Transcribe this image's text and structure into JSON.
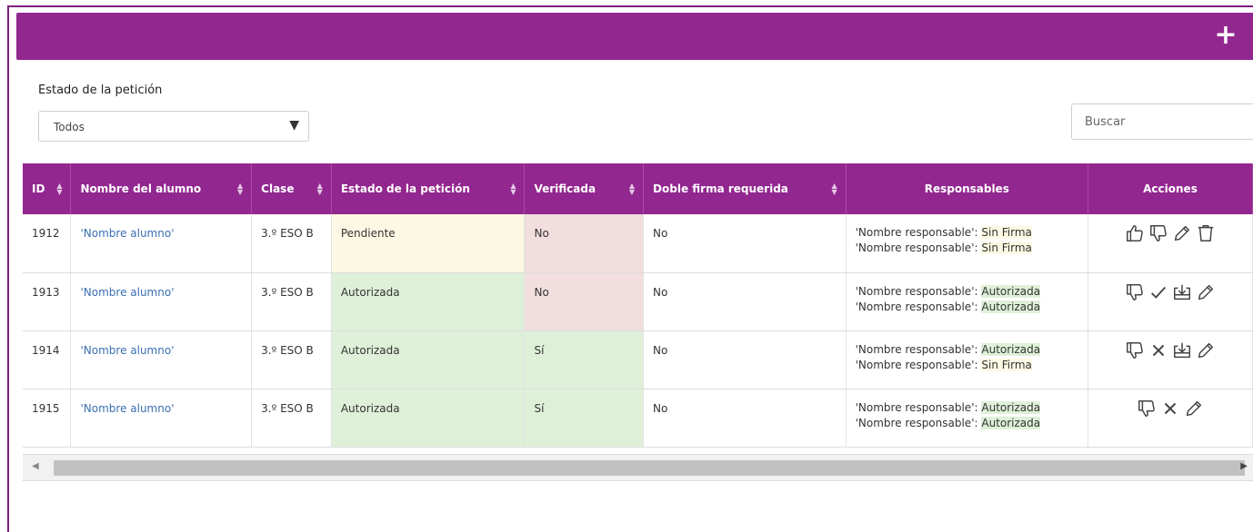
{
  "toolbar": {
    "add_label": "+"
  },
  "filter": {
    "label": "Estado de la petición",
    "selected": "Todos"
  },
  "search": {
    "placeholder": "Buscar"
  },
  "table": {
    "headers": [
      "ID",
      "Nombre del alumno",
      "Clase",
      "Estado de la petición",
      "Verificada",
      "Doble firma requerida",
      "Responsables",
      "Acciones"
    ],
    "rows": [
      {
        "id": "1912",
        "alumno": "'Nombre alumno'",
        "clase": "3.º ESO B",
        "estado": "Pendiente",
        "verificada": "No",
        "doble": "No",
        "responsables": [
          {
            "name": "'Nombre responsable':",
            "status": "Sin Firma"
          },
          {
            "name": "'Nombre responsable':",
            "status": "Sin Firma"
          }
        ],
        "actions": [
          "thumbs-up-icon",
          "thumbs-down-icon",
          "pencil-icon",
          "trash-icon"
        ]
      },
      {
        "id": "1913",
        "alumno": "'Nombre alumno'",
        "clase": "3.º ESO B",
        "estado": "Autorizada",
        "verificada": "No",
        "doble": "No",
        "responsables": [
          {
            "name": "'Nombre responsable':",
            "status": "Autorizada"
          },
          {
            "name": "'Nombre responsable':",
            "status": "Autorizada"
          }
        ],
        "actions": [
          "thumbs-down-icon",
          "check-icon",
          "download-icon",
          "pencil-icon"
        ]
      },
      {
        "id": "1914",
        "alumno": "'Nombre alumno'",
        "clase": "3.º ESO B",
        "estado": "Autorizada",
        "verificada": "Sí",
        "doble": "No",
        "responsables": [
          {
            "name": "'Nombre responsable':",
            "status": "Autorizada"
          },
          {
            "name": "'Nombre responsable':",
            "status": "Sin Firma"
          }
        ],
        "actions": [
          "thumbs-down-icon",
          "close-icon",
          "download-icon",
          "pencil-icon"
        ]
      },
      {
        "id": "1915",
        "alumno": "'Nombre alumno'",
        "clase": "3.º ESO B",
        "estado": "Autorizada",
        "verificada": "Sí",
        "doble": "No",
        "responsables": [
          {
            "name": "'Nombre responsable':",
            "status": "Autorizada"
          },
          {
            "name": "'Nombre responsable':",
            "status": "Autorizada"
          }
        ],
        "actions": [
          "thumbs-down-icon",
          "close-icon",
          "pencil-icon"
        ]
      }
    ]
  },
  "colors": {
    "brand": "#92278f",
    "pending_bg": "#fcf8e3",
    "ok_bg": "#dff0d8",
    "no_bg": "#f2dede",
    "link": "#3a6fb0"
  }
}
